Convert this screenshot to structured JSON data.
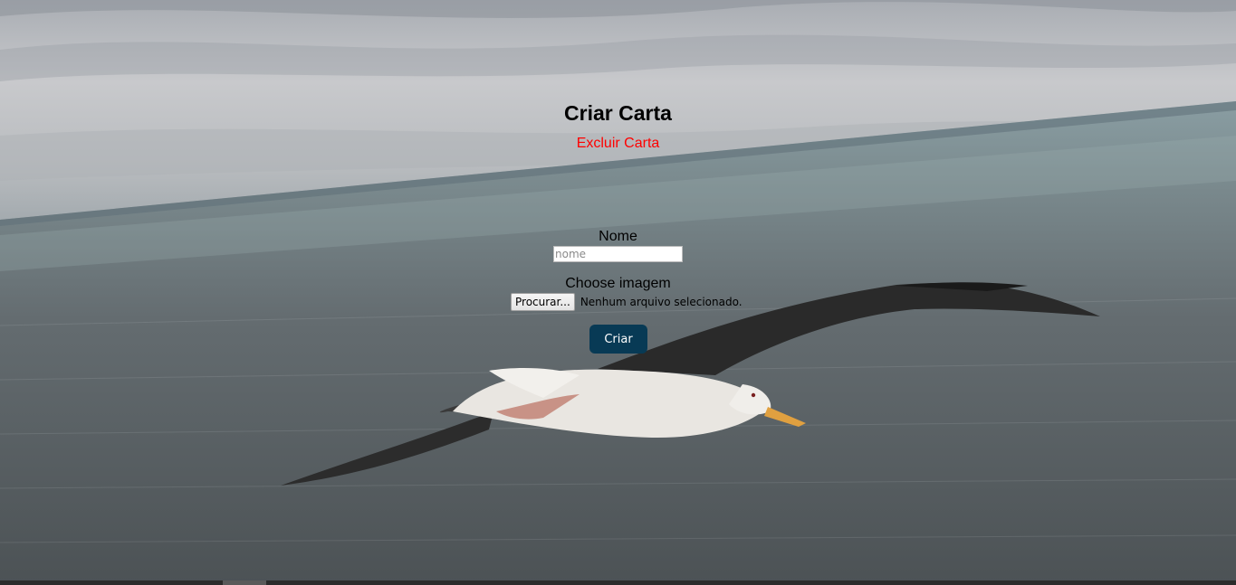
{
  "form": {
    "title": "Criar Carta",
    "delete_link": "Excluir Carta",
    "name_label": "Nome",
    "name_placeholder": "nome",
    "name_value": "",
    "image_label": "Choose imagem",
    "file_button": "Procurar...",
    "file_status": "Nenhum arquivo selecionado.",
    "submit_label": "Criar"
  },
  "colors": {
    "delete_link": "#ff0000",
    "submit_bg": "#083a55",
    "submit_text": "#ffffff"
  },
  "background": {
    "subject": "seagull-over-sea-photo"
  }
}
